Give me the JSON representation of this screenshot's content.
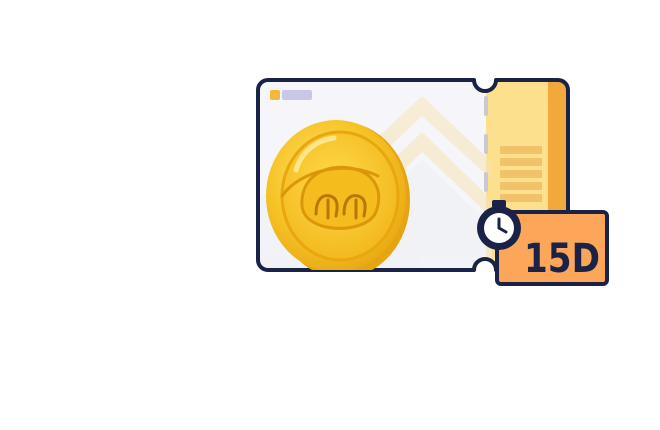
{
  "voucher": {
    "duration_label": "15D",
    "colors": {
      "outline": "#1a2347",
      "ticket_bg": "#f6f6fa",
      "stub_bg": "#fde08e",
      "stub_edge": "#f0a93a",
      "coin_gold": "#f5c324",
      "coin_dark": "#e3a10d",
      "badge_bg": "#fca65a",
      "badge_text": "#1a2347"
    },
    "icons": [
      "coin-icon",
      "stopwatch-icon",
      "chevron-watermark-icon"
    ]
  }
}
